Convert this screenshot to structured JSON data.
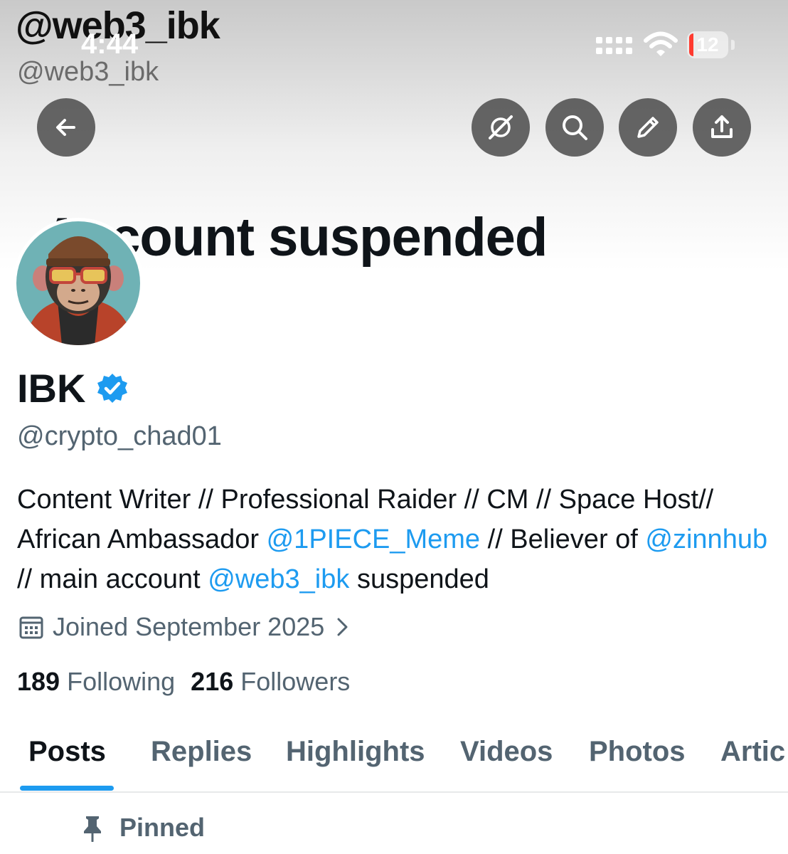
{
  "banner": {
    "handle_large": "@web3_ibk",
    "handle_small": "@web3_ibk",
    "suspended_text": "Account suspended"
  },
  "status_bar": {
    "time": "4:44",
    "battery": "12",
    "battery_color": "#ff3b30"
  },
  "toolbar": {
    "back_icon": "arrow-left-icon",
    "actions": [
      "grok-icon",
      "search-icon",
      "edit-pencil-icon",
      "share-icon"
    ]
  },
  "profile": {
    "display_name": "IBK",
    "verified_icon": "verified-badge-icon",
    "username": "@crypto_chad01",
    "bio": {
      "t1": "Content Writer // Professional Raider // CM // Space Host// African Ambassador ",
      "m1": "@1PIECE_Meme",
      "t2": " // Believer of ",
      "m2": "@zinnhub",
      "t3": " // main account ",
      "m3": "@web3_ibk",
      "t4": " suspended"
    },
    "joined": "Joined September 2025",
    "following_count": "189",
    "following_label": "Following",
    "followers_count": "216",
    "followers_label": "Followers"
  },
  "tabs": {
    "posts": "Posts",
    "replies": "Replies",
    "highlights": "Highlights",
    "videos": "Videos",
    "photos": "Photos",
    "articles": "Artic"
  },
  "pinned": {
    "label": "Pinned"
  },
  "colors": {
    "accent": "#1d9bf0",
    "muted_text": "#536471",
    "primary_text": "#0f1419"
  }
}
